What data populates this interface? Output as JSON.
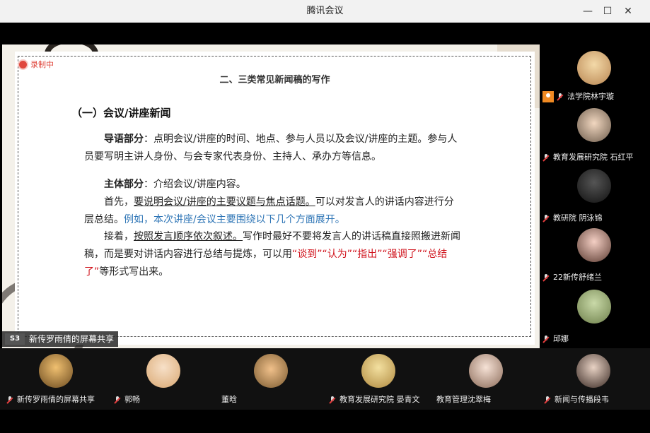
{
  "window": {
    "title": "腾讯会议",
    "min": "—",
    "max": "☐",
    "close": "✕"
  },
  "recording": {
    "label": "录制中"
  },
  "slide": {
    "title": "二、三类常见新闻稿的写作",
    "heading": "（一）会议/讲座新闻",
    "p1_bold": "导语部分",
    "p1_text": "：点明会议/讲座的时间、地点、参与人员以及会议/讲座的主题。参与人员要写明主讲人身份、与会专家代表身份、主持人、承办方等信息。",
    "p2_bold": "主体部分",
    "p2_text": "：介绍会议/讲座内容。",
    "p3_pre": "首先，",
    "p3_under": "要说明会议/讲座的主要议题与焦点话题。",
    "p3_text": "可以对发言人的讲话内容进行分层总结。",
    "p3_blue": "例如，本次讲座/会议主要围绕以下几个方面展开。",
    "p4_pre": "接着，",
    "p4_under": "按照发言顺序依次叙述。",
    "p4_text": "写作时最好不要将发言人的讲话稿直接照搬进新闻稿，而是要对讲话内容进行总结与提炼，可以用",
    "p4_red": "“谈到”“认为”“指出”“强调了”“总结了”",
    "p4_end": "等形式写出来。"
  },
  "share": {
    "icon": "S3",
    "label": "新传罗雨倩的屏幕共享"
  },
  "right_participants": [
    {
      "name": "法学院林宇璇"
    },
    {
      "name": "教育发展研究院 石红平"
    },
    {
      "name": "教研院 阴泳锦"
    },
    {
      "name": "22新传舒绪兰"
    },
    {
      "name": "邱娜"
    }
  ],
  "bottom_participants": [
    {
      "name": "新传罗雨倩的屏幕共享"
    },
    {
      "name": "郭畅"
    },
    {
      "name": "董晗"
    },
    {
      "name": "教育发展研究院 晏青文"
    },
    {
      "name": "教育管理沈翠梅"
    },
    {
      "name": "新闻与传播段韦"
    }
  ],
  "colors": {
    "accent_red": "#d0121b",
    "accent_blue": "#2e75b6",
    "rec_red": "#e0483e"
  }
}
